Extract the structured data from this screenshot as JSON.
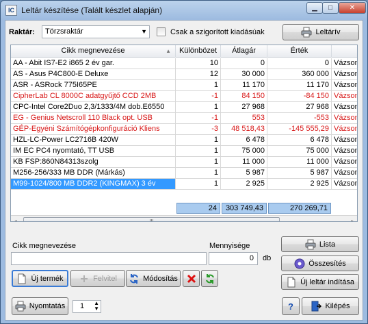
{
  "window": {
    "title": "Leltár készítése  (Talált készlet alapján)",
    "app_icon": "IC",
    "minimize_glyph": "▁",
    "maximize_glyph": "□",
    "close_glyph": "✕"
  },
  "toolbar": {
    "raktar_label": "Raktár:",
    "raktar_value": "Törzsraktár",
    "checkbox_label": "Csak a szigorított kiadásúak",
    "leltariv_button": "Leltárív"
  },
  "table": {
    "columns": [
      "Cikk megnevezése",
      "Különbözet",
      "Átlagár",
      "Érték",
      ""
    ],
    "rows": [
      {
        "name": "AA - Abit IS7-E2 i865 2 év gar.",
        "kulonbozet": "10",
        "atlagar": "0",
        "ertek": "0",
        "extra": "Vázsonyin",
        "red": false
      },
      {
        "name": "AS - Asus P4C800-E Deluxe",
        "kulonbozet": "12",
        "atlagar": "30 000",
        "ertek": "360 000",
        "extra": "Vázsonyin",
        "red": false
      },
      {
        "name": "ASR - ASRock 775I65PE",
        "kulonbozet": "1",
        "atlagar": "11 170",
        "ertek": "11 170",
        "extra": "Vázsonyin",
        "red": false
      },
      {
        "name": "CipherLab CL 8000C adatgyűjtő CCD 2MB",
        "kulonbozet": "-1",
        "atlagar": "84 150",
        "ertek": "-84 150",
        "extra": "Vázsonyin",
        "red": true
      },
      {
        "name": "CPC-Intel Core2Duo 2,3/1333/4M dob.E6550",
        "kulonbozet": "1",
        "atlagar": "27 968",
        "ertek": "27 968",
        "extra": "Vázsonyin",
        "red": false
      },
      {
        "name": "EG - Genius Netscroll 110 Black opt. USB",
        "kulonbozet": "-1",
        "atlagar": "553",
        "ertek": "-553",
        "extra": "Vázsonyin",
        "red": true
      },
      {
        "name": "GÉP-Egyéni Számítógépkonfiguráció Kliens",
        "kulonbozet": "-3",
        "atlagar": "48 518,43",
        "ertek": "-145 555,29",
        "extra": "Vázsonyin",
        "red": true
      },
      {
        "name": "HZL-LC-Power LC2716B 420W",
        "kulonbozet": "1",
        "atlagar": "6 478",
        "ertek": "6 478",
        "extra": "Vázsonyin",
        "red": false
      },
      {
        "name": "IM EC PC4 nyomtató, TT USB",
        "kulonbozet": "1",
        "atlagar": "75 000",
        "ertek": "75 000",
        "extra": "Vázsonyin",
        "red": false
      },
      {
        "name": "KB FSP:860N84313szolg",
        "kulonbozet": "1",
        "atlagar": "11 000",
        "ertek": "11 000",
        "extra": "Vázsonyin",
        "red": false
      },
      {
        "name": "M256-256/333 MB DDR (Márkás)",
        "kulonbozet": "1",
        "atlagar": "5 987",
        "ertek": "5 987",
        "extra": "Vázsonyin",
        "red": false
      },
      {
        "name": "M99-1024/800 MB DDR2 (KINGMAX) 3 év",
        "kulonbozet": "1",
        "atlagar": "2 925",
        "ertek": "2 925",
        "extra": "Vázsonyin",
        "red": false,
        "selected": true
      }
    ],
    "totals": {
      "kulonbozet": "24",
      "atlagar": "303 749,43",
      "ertek": "270 269,71"
    },
    "scroll_left": "◂",
    "scroll_right": "▸",
    "scroll_thumb": "|||"
  },
  "form": {
    "cikk_label": "Cikk megnevezése",
    "cikk_value": "",
    "mennyiseg_label": "Mennyisége",
    "mennyiseg_value": "0",
    "unit": "db"
  },
  "buttons": {
    "uj_termek": "Új termék",
    "felvitel": "Felvitel",
    "modositas": "Módosítás",
    "lista": "Lista",
    "osszesites": "Összesítés",
    "uj_leltar": "Új leltár indítása",
    "nyomtatas": "Nyomtatás",
    "copies": "1",
    "kilepes": "Kilépés",
    "help": "?"
  }
}
